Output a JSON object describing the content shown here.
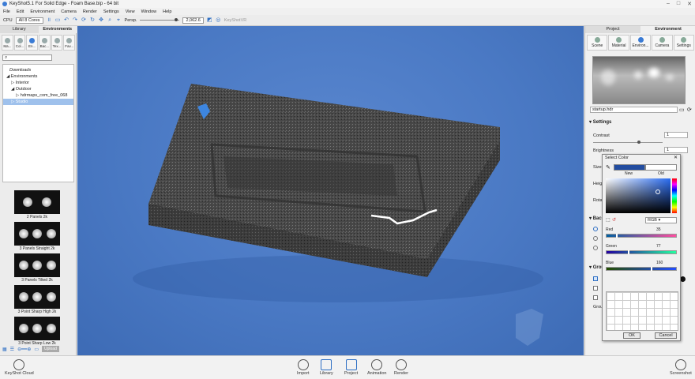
{
  "window": {
    "title": "KeyShot5.1 For Solid Edge - Foam Base.bip - 64 bit"
  },
  "menu": [
    "File",
    "Edit",
    "Environment",
    "Camera",
    "Render",
    "Settings",
    "View",
    "Window",
    "Help"
  ],
  "toolbar": {
    "cpu_label": "CPU",
    "cores": "All 8 Cores",
    "persp": "Persp.",
    "zoom": "2,062.6",
    "keyshotvr": "KeyShotVR"
  },
  "left_panel": {
    "tabs": [
      "Library",
      "Environments"
    ],
    "categories": [
      "Ma...",
      "Col...",
      "En...",
      "Bac...",
      "Tex...",
      "Fav..."
    ],
    "tree": [
      "Downloads",
      "Environments",
      "Interior",
      "Outdoor",
      "hdrmaps_com_free_068",
      "Studio"
    ],
    "thumbnails": [
      "2 Panels 2k",
      "3 Panels Straight 2k",
      "3 Panels Tilted 2k",
      "3 Point Sharp High 2k",
      "3 Point Sharp Low 2k"
    ],
    "upload": "Upload"
  },
  "right_panel": {
    "tabs": [
      "Project",
      "Environment"
    ],
    "subtabs": [
      "Scene",
      "Material",
      "Environ...",
      "Camera",
      "Settings"
    ],
    "hdr_file": "startup.hdr",
    "settings_title": "Settings",
    "contrast_label": "Contrast",
    "contrast_value": "1",
    "brightness_label": "Brightness",
    "brightness_value": "1",
    "size_label": "Size",
    "height_label": "Heigh",
    "rotation_label": "Rota",
    "background_label": "Back",
    "ground_label": "Grou",
    "ground_sub": "Grou"
  },
  "color_dialog": {
    "title": "Select Color",
    "new_label": "New",
    "old_label": "Old",
    "mode": "RGB",
    "red_label": "Red",
    "red_value": "35",
    "green_label": "Green",
    "green_value": "77",
    "blue_label": "Blue",
    "blue_value": "160",
    "ok": "OK",
    "cancel": "Cancel",
    "new_color": "#234da0",
    "old_color": "#ffffff"
  },
  "bottom_bar": {
    "cloud": "KeyShot Cloud",
    "items": [
      "Import",
      "Library",
      "Project",
      "Animation",
      "Render"
    ],
    "screenshot": "Screenshot"
  },
  "colors": {
    "viewport": "#4a79c4",
    "accent": "#2e6fc4"
  }
}
